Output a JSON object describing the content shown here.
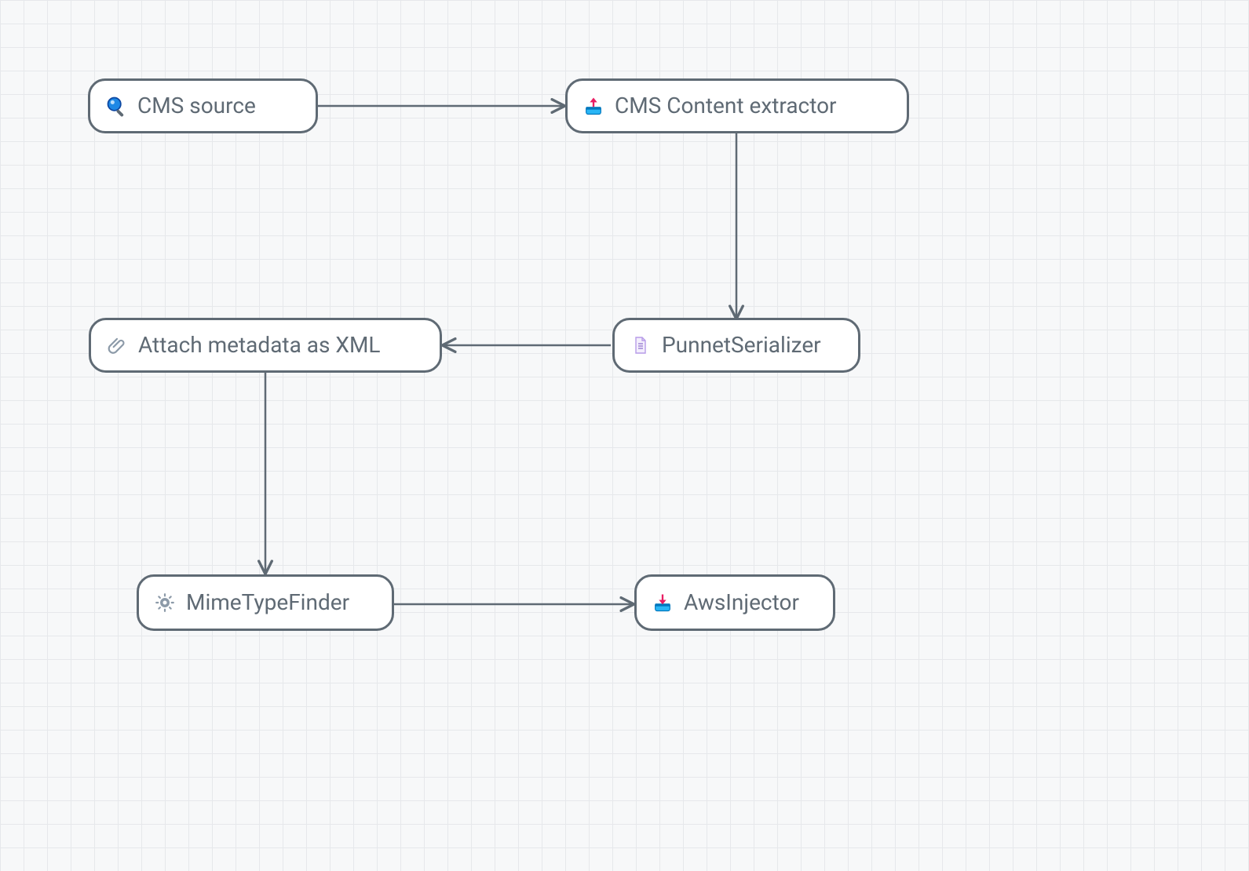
{
  "nodes": {
    "cms_source": {
      "label": "CMS source",
      "icon": "search-icon"
    },
    "cms_extract": {
      "label": "CMS Content extractor",
      "icon": "upload-icon"
    },
    "attach_xml": {
      "label": "Attach metadata as XML",
      "icon": "paperclip-icon"
    },
    "punnet": {
      "label": "PunnetSerializer",
      "icon": "document-icon"
    },
    "mimetype": {
      "label": "MimeTypeFinder",
      "icon": "gear-icon"
    },
    "aws": {
      "label": "AwsInjector",
      "icon": "download-icon"
    }
  },
  "edges": [
    {
      "from": "cms_source",
      "to": "cms_extract"
    },
    {
      "from": "cms_extract",
      "to": "punnet"
    },
    {
      "from": "punnet",
      "to": "attach_xml"
    },
    {
      "from": "attach_xml",
      "to": "mimetype"
    },
    {
      "from": "mimetype",
      "to": "aws"
    }
  ]
}
